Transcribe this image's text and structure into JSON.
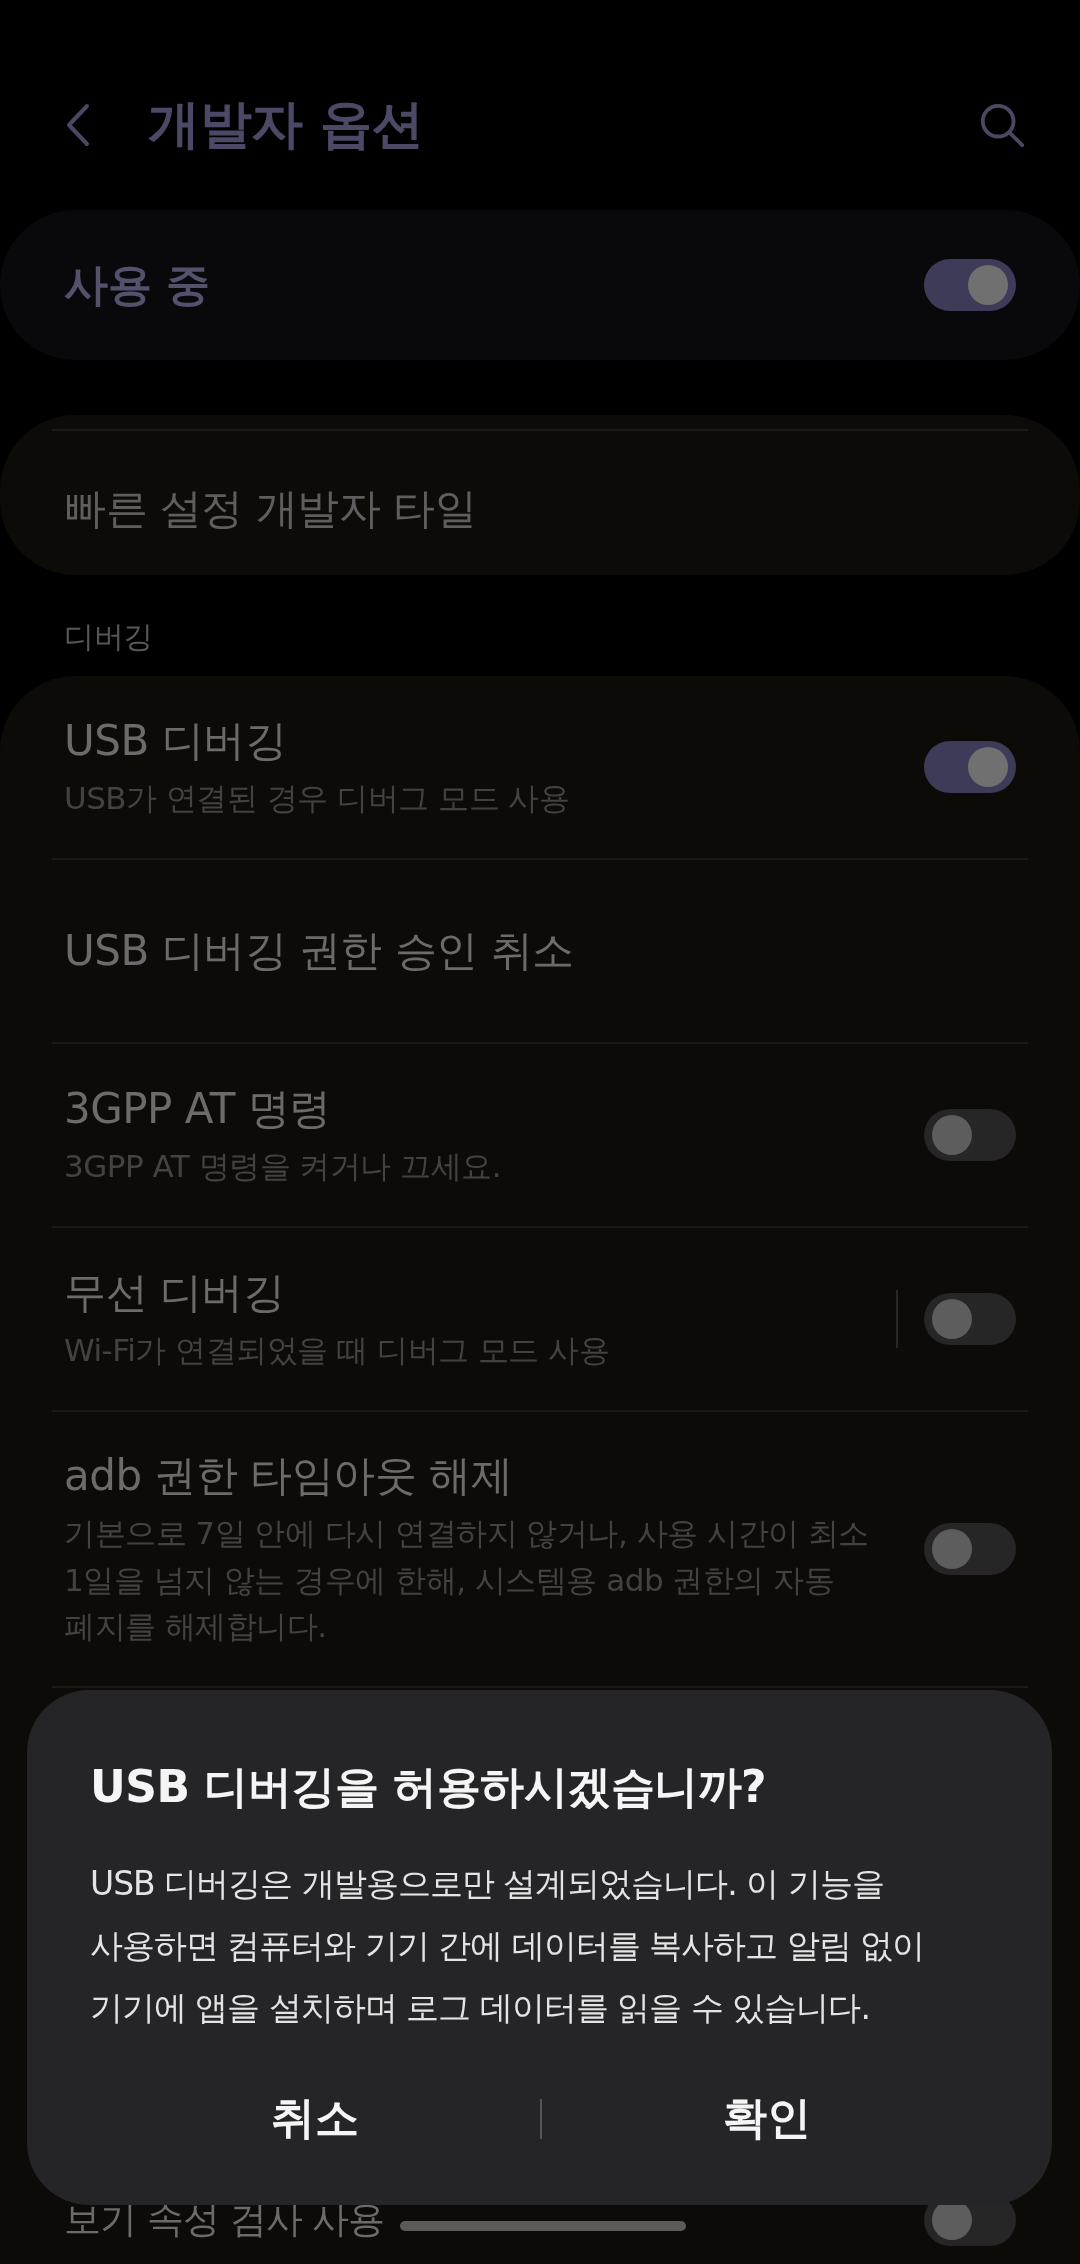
{
  "header": {
    "title": "개발자 옵션"
  },
  "master_switch": {
    "label": "사용 중",
    "on": true
  },
  "quick_settings": {
    "label": "빠른 설정 개발자 타일"
  },
  "section": {
    "title": "디버깅"
  },
  "items": [
    {
      "kind": "switch",
      "title": "USB 디버깅",
      "summary": "USB가 연결된 경우 디버그 모드 사용",
      "on": true
    },
    {
      "kind": "plain",
      "title": "USB 디버깅 권한 승인 취소"
    },
    {
      "kind": "switch",
      "title": "3GPP AT 명령",
      "summary": "3GPP AT 명령을 켜거나 끄세요.",
      "on": false
    },
    {
      "kind": "split_switch",
      "title": "무선 디버깅",
      "summary": "Wi-Fi가 연결되었을 때 디버그 모드 사용",
      "on": false
    },
    {
      "kind": "switch",
      "title": "adb 권한 타임아웃 해제",
      "summary": "기본으로 7일 안에 다시 연결하지 않거나, 사용 시간이 최소 1일을 넘지 않는 경우에 한해, 시스템용 adb 권한의 자동 폐지를 해제합니다.",
      "on": false
    },
    {
      "kind": "switch",
      "title": "보기 속성 검사 사용",
      "on": false
    }
  ],
  "dialog": {
    "title": "USB 디버깅을 허용하시겠습니까?",
    "message": "USB 디버깅은 개발용으로만 설계되었습니다. 이 기능을 사용하면 컴퓨터와 기기 간에 데이터를 복사하고 알림 없이 기기에 앱을 설치하며 로그 데이터를 읽을 수 있습니다.",
    "buttons": [
      "취소",
      "확인"
    ]
  }
}
